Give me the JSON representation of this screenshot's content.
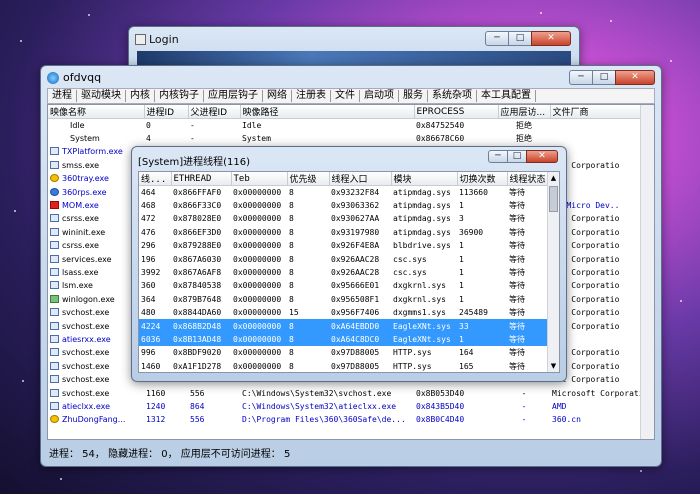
{
  "login": {
    "title": "Login"
  },
  "main": {
    "title": "ofdvqq",
    "menu": [
      "进程",
      "驱动模块",
      "内核",
      "内核钩子",
      "应用层钩子",
      "网络",
      "注册表",
      "文件",
      "启动项",
      "服务",
      "系统杂项",
      "本工具配置"
    ],
    "columns": [
      "映像名称",
      "进程ID",
      "父进程ID",
      "映像路径",
      "EPROCESS",
      "应用层访...",
      "文件厂商"
    ],
    "processes": [
      {
        "name": "Idle",
        "pid": "0",
        "ppid": "-",
        "path": "Idle",
        "eprocess": "0x84752540",
        "access": "拒绝",
        "vendor": ""
      },
      {
        "name": "System",
        "pid": "4",
        "ppid": "-",
        "path": "System",
        "eprocess": "0x86678C60",
        "access": "拒绝",
        "vendor": ""
      },
      {
        "name": "TXPlatform.exe",
        "pid": "",
        "ppid": "",
        "path": "",
        "eprocess": "",
        "access": "",
        "vendor": ""
      },
      {
        "name": "smss.exe",
        "pid": "",
        "ppid": "",
        "path": "",
        "eprocess": "",
        "access": "",
        "vendor": "oft Corporatio"
      },
      {
        "name": "360tray.exe",
        "pid": "",
        "ppid": "",
        "path": "",
        "eprocess": "",
        "access": "",
        "vendor": ""
      },
      {
        "name": "360rps.exe",
        "pid": "",
        "ppid": "",
        "path": "",
        "eprocess": "",
        "access": "",
        "vendor": ""
      },
      {
        "name": "MOM.exe",
        "pid": "",
        "ppid": "",
        "path": "",
        "eprocess": "",
        "access": "",
        "vendor": "ed Micro Dev.."
      },
      {
        "name": "csrss.exe",
        "pid": "",
        "ppid": "",
        "path": "",
        "eprocess": "",
        "access": "",
        "vendor": "oft Corporatio"
      },
      {
        "name": "wininit.exe",
        "pid": "",
        "ppid": "",
        "path": "",
        "eprocess": "",
        "access": "",
        "vendor": "oft Corporatio"
      },
      {
        "name": "csrss.exe",
        "pid": "",
        "ppid": "",
        "path": "",
        "eprocess": "",
        "access": "",
        "vendor": "oft Corporatio"
      },
      {
        "name": "services.exe",
        "pid": "",
        "ppid": "",
        "path": "",
        "eprocess": "",
        "access": "",
        "vendor": "oft Corporatio"
      },
      {
        "name": "lsass.exe",
        "pid": "",
        "ppid": "",
        "path": "",
        "eprocess": "",
        "access": "",
        "vendor": "oft Corporatio"
      },
      {
        "name": "lsm.exe",
        "pid": "",
        "ppid": "",
        "path": "",
        "eprocess": "",
        "access": "",
        "vendor": "oft Corporatio"
      },
      {
        "name": "winlogon.exe",
        "pid": "",
        "ppid": "",
        "path": "",
        "eprocess": "",
        "access": "",
        "vendor": "oft Corporatio"
      },
      {
        "name": "svchost.exe",
        "pid": "",
        "ppid": "",
        "path": "",
        "eprocess": "",
        "access": "",
        "vendor": "oft Corporatio"
      },
      {
        "name": "svchost.exe",
        "pid": "",
        "ppid": "",
        "path": "",
        "eprocess": "",
        "access": "",
        "vendor": "oft Corporatio"
      },
      {
        "name": "atiesrxx.exe",
        "pid": "",
        "ppid": "",
        "path": "",
        "eprocess": "",
        "access": "",
        "vendor": ""
      },
      {
        "name": "svchost.exe",
        "pid": "",
        "ppid": "",
        "path": "",
        "eprocess": "",
        "access": "",
        "vendor": "oft Corporatio"
      },
      {
        "name": "svchost.exe",
        "pid": "",
        "ppid": "",
        "path": "",
        "eprocess": "",
        "access": "",
        "vendor": "oft Corporatio"
      },
      {
        "name": "svchost.exe",
        "pid": "",
        "ppid": "",
        "path": "",
        "eprocess": "",
        "access": "",
        "vendor": "oft Corporatio"
      },
      {
        "name": "svchost.exe",
        "pid": "1160",
        "ppid": "556",
        "path": "C:\\Windows\\System32\\svchost.exe",
        "eprocess": "0x8B053D40",
        "access": "-",
        "vendor": "Microsoft Corporatio"
      },
      {
        "name": "atieclxx.exe",
        "pid": "1240",
        "ppid": "864",
        "path": "C:\\Windows\\System32\\atieclxx.exe",
        "eprocess": "0x843B5D40",
        "access": "-",
        "vendor": "AMD"
      },
      {
        "name": "ZhuDongFang...",
        "pid": "1312",
        "ppid": "556",
        "path": "D:\\Program Files\\360\\360Safe\\de...",
        "eprocess": "0x8B0C4D40",
        "access": "-",
        "vendor": "360.cn"
      }
    ],
    "status": "进程： 54， 隐藏进程： 0， 应用层不可访问进程： 5"
  },
  "threads": {
    "title": "[System]进程线程(116)",
    "columns": [
      "线...",
      "ETHREAD",
      "Teb",
      "优先级",
      "线程入口",
      "模块",
      "切换次数",
      "线程状态"
    ],
    "rows": [
      [
        "464",
        "0x866FFAF0",
        "0x00000000",
        "8",
        "0x93232F84",
        "atipmdag.sys",
        "113660",
        "等待"
      ],
      [
        "468",
        "0x866F33C0",
        "0x00000000",
        "8",
        "0x93063362",
        "atipmdag.sys",
        "1",
        "等待"
      ],
      [
        "472",
        "0x878028E0",
        "0x00000000",
        "8",
        "0x930627AA",
        "atipmdag.sys",
        "3",
        "等待"
      ],
      [
        "476",
        "0x866EF3D0",
        "0x00000000",
        "8",
        "0x93197980",
        "atipmdag.sys",
        "36900",
        "等待"
      ],
      [
        "296",
        "0x879288E0",
        "0x00000000",
        "8",
        "0x926F4E8A",
        "blbdrive.sys",
        "1",
        "等待"
      ],
      [
        "196",
        "0x867A6030",
        "0x00000000",
        "8",
        "0x926AAC28",
        "csc.sys",
        "1",
        "等待"
      ],
      [
        "3992",
        "0x867A6AF8",
        "0x00000000",
        "8",
        "0x926AAC28",
        "csc.sys",
        "1",
        "等待"
      ],
      [
        "360",
        "0x87840538",
        "0x00000000",
        "8",
        "0x95666E01",
        "dxgkrnl.sys",
        "1",
        "等待"
      ],
      [
        "364",
        "0x879B7648",
        "0x00000000",
        "8",
        "0x956508F1",
        "dxgkrnl.sys",
        "1",
        "等待"
      ],
      [
        "480",
        "0x8844DA60",
        "0x00000000",
        "15",
        "0x956F7406",
        "dxgmms1.sys",
        "245489",
        "等待"
      ],
      [
        "4224",
        "0x868B2D48",
        "0x00000000",
        "8",
        "0xA64EBDD0",
        "EagleXNt.sys",
        "33",
        "等待"
      ],
      [
        "6036",
        "0x8B13AD48",
        "0x00000000",
        "8",
        "0xA64C8DC0",
        "EagleXNt.sys",
        "1",
        "等待"
      ],
      [
        "996",
        "0x8BDF9020",
        "0x00000000",
        "8",
        "0x97D88005",
        "HTTP.sys",
        "164",
        "等待"
      ],
      [
        "1460",
        "0xA1F1D278",
        "0x00000000",
        "8",
        "0x97D88005",
        "HTTP.sys",
        "165",
        "等待"
      ],
      [
        "1708",
        "0x8BB20D48",
        "0x00000000",
        "8",
        "0x97D88005",
        "HTTP.sys",
        "2",
        "等待"
      ],
      [
        "1712",
        "0x8BB20A70",
        "0x00000000",
        "11",
        "0x97D88005",
        "HTTP.sys",
        "14",
        "等待"
      ],
      [
        "1716",
        "0x8BB21D48",
        "0x00000000",
        "8",
        "0x97D886CB",
        "HTTP.sys",
        "48",
        "等待"
      ]
    ],
    "selected_rows": [
      10,
      11
    ]
  },
  "icons": {
    "min": "─",
    "max": "□",
    "close": "✕",
    "up": "▲",
    "down": "▼"
  }
}
